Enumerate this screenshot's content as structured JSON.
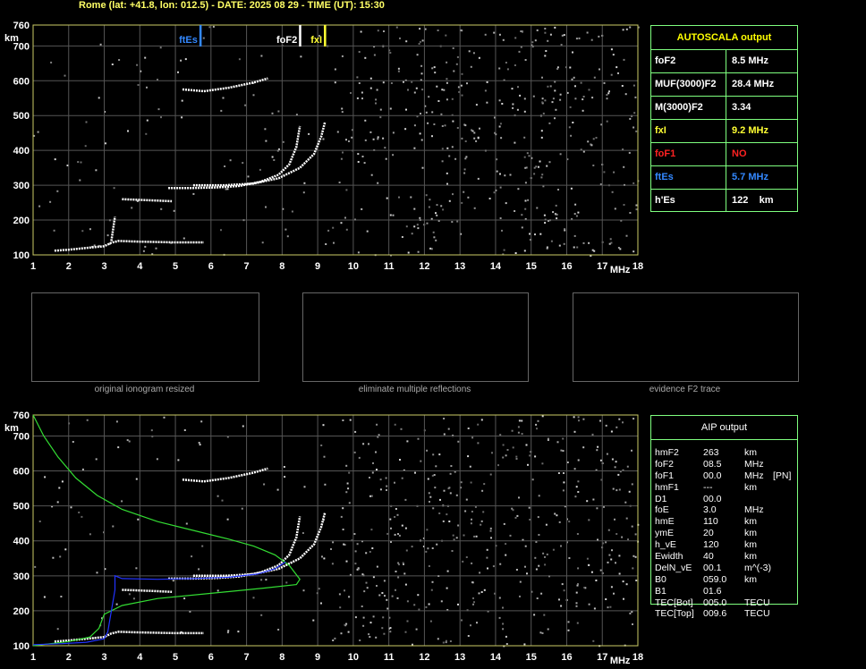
{
  "header": {
    "title": "Rome (lat: +41.8, lon: 012.5) - DATE: 2025 08 29 - TIME (UT): 15:30"
  },
  "axes": {
    "y_unit": "km",
    "x_unit": "MHz",
    "y_ticks": [
      "100",
      "200",
      "300",
      "400",
      "500",
      "600",
      "700",
      "760"
    ],
    "x_ticks": [
      "1",
      "2",
      "3",
      "4",
      "5",
      "6",
      "7",
      "8",
      "9",
      "10",
      "11",
      "12",
      "13",
      "14",
      "15",
      "16",
      "17",
      "18"
    ]
  },
  "markers": {
    "ftEs": "ftEs",
    "foF2": "foF2",
    "fxI": "fxI"
  },
  "autoscala": {
    "title": "AUTOSCALA output",
    "rows": [
      {
        "label": "foF2",
        "value": "8.5 MHz",
        "color": "#ffffff"
      },
      {
        "label": "MUF(3000)F2",
        "value": "28.4 MHz",
        "color": "#ffffff"
      },
      {
        "label": "M(3000)F2",
        "value": "3.34",
        "color": "#ffffff"
      },
      {
        "label": "fxI",
        "value": "9.2 MHz",
        "color": "#ffff33"
      },
      {
        "label": "foF1",
        "value": "NO",
        "color": "#ff2222"
      },
      {
        "label": "ftEs",
        "value": "5.7 MHz",
        "color": "#3388ff"
      },
      {
        "label": "h'Es",
        "value": "122    km",
        "color": "#ffffff"
      }
    ]
  },
  "thumbnails": {
    "captions": [
      "original ionogram resized",
      "eliminate multiple reflections",
      "evidence F2 trace"
    ]
  },
  "aip": {
    "title": "AIP output",
    "rows": [
      {
        "name": "hmF2",
        "value": "263",
        "unit": "km",
        "extra": ""
      },
      {
        "name": "foF2",
        "value": "08.5",
        "unit": "MHz",
        "extra": ""
      },
      {
        "name": "foF1",
        "value": "00.0",
        "unit": "MHz",
        "extra": "[PN]"
      },
      {
        "name": "hmF1",
        "value": "---",
        "unit": "km",
        "extra": ""
      },
      {
        "name": "D1",
        "value": "00.0",
        "unit": "",
        "extra": ""
      },
      {
        "name": "foE",
        "value": "3.0",
        "unit": "MHz",
        "extra": ""
      },
      {
        "name": "hmE",
        "value": "110",
        "unit": "km",
        "extra": ""
      },
      {
        "name": "ymE",
        "value": "20",
        "unit": "km",
        "extra": ""
      },
      {
        "name": "h_vE",
        "value": "120",
        "unit": "km",
        "extra": ""
      },
      {
        "name": "Ewidth",
        "value": "40",
        "unit": "km",
        "extra": ""
      },
      {
        "name": "DelN_vE",
        "value": "00.1",
        "unit": "m^(-3)",
        "extra": ""
      },
      {
        "name": "B0",
        "value": "059.0",
        "unit": "km",
        "extra": ""
      },
      {
        "name": "B1",
        "value": "01.6",
        "unit": "",
        "extra": ""
      },
      {
        "name": "TEC[Bot]",
        "value": "005.0",
        "unit": "TECU",
        "extra": ""
      },
      {
        "name": "TEC[Top]",
        "value": "009.6",
        "unit": "TECU",
        "extra": ""
      }
    ]
  },
  "chart_data": [
    {
      "type": "scatter",
      "title": "",
      "xlabel": "MHz",
      "ylabel": "km",
      "xlim": [
        1,
        18
      ],
      "ylim": [
        100,
        760
      ],
      "grid": true,
      "markers": [
        {
          "label": "ftEs",
          "x": 5.7,
          "color": "#3388ff"
        },
        {
          "label": "foF2",
          "x": 8.5,
          "color": "#ffffff"
        },
        {
          "label": "fxI",
          "x": 9.2,
          "color": "#ffff33"
        }
      ],
      "series": [
        {
          "color": "#ffffff",
          "points": [
            [
              1.6,
              112
            ],
            [
              2.0,
              115
            ],
            [
              2.5,
              120
            ],
            [
              3.0,
              125
            ],
            [
              3.2,
              135
            ],
            [
              3.4,
              140
            ],
            [
              4.0,
              138
            ],
            [
              5.0,
              136
            ],
            [
              5.8,
              136
            ]
          ]
        },
        {
          "color": "#ffffff",
          "points": [
            [
              3.2,
              140
            ],
            [
              3.25,
              175
            ],
            [
              3.3,
              210
            ]
          ]
        },
        {
          "color": "#ffffff",
          "points": [
            [
              4.8,
              292
            ],
            [
              5.5,
              292
            ],
            [
              6.2,
              294
            ],
            [
              6.8,
              298
            ],
            [
              7.4,
              310
            ],
            [
              7.9,
              330
            ],
            [
              8.2,
              360
            ],
            [
              8.4,
              410
            ],
            [
              8.5,
              470
            ]
          ]
        },
        {
          "color": "#ffffff",
          "points": [
            [
              5.5,
              300
            ],
            [
              6.4,
              300
            ],
            [
              7.2,
              305
            ],
            [
              7.9,
              320
            ],
            [
              8.5,
              350
            ],
            [
              8.9,
              390
            ],
            [
              9.1,
              440
            ],
            [
              9.2,
              480
            ]
          ]
        },
        {
          "color": "#ffffff",
          "points": [
            [
              3.5,
              260
            ],
            [
              4.0,
              258
            ],
            [
              4.5,
              256
            ],
            [
              4.9,
              254
            ]
          ]
        },
        {
          "color": "#ffffff",
          "points": [
            [
              5.2,
              575
            ],
            [
              5.8,
              570
            ],
            [
              6.5,
              580
            ],
            [
              7.2,
              595
            ],
            [
              7.6,
              607
            ]
          ]
        }
      ]
    },
    {
      "type": "line",
      "title": "",
      "xlabel": "MHz",
      "ylabel": "km",
      "xlim": [
        1,
        18
      ],
      "ylim": [
        100,
        760
      ],
      "grid": true,
      "series": [
        {
          "color": "#ffffff",
          "points": [
            [
              1.6,
              112
            ],
            [
              2.0,
              115
            ],
            [
              2.5,
              120
            ],
            [
              3.0,
              125
            ],
            [
              3.2,
              135
            ],
            [
              3.4,
              140
            ],
            [
              4.0,
              138
            ],
            [
              5.0,
              136
            ],
            [
              5.8,
              136
            ]
          ]
        },
        {
          "color": "#ffffff",
          "points": [
            [
              4.8,
              292
            ],
            [
              5.5,
              292
            ],
            [
              6.2,
              294
            ],
            [
              6.8,
              298
            ],
            [
              7.4,
              310
            ],
            [
              7.9,
              330
            ],
            [
              8.2,
              360
            ],
            [
              8.4,
              410
            ],
            [
              8.5,
              470
            ]
          ]
        },
        {
          "color": "#ffffff",
          "points": [
            [
              5.5,
              300
            ],
            [
              6.4,
              300
            ],
            [
              7.2,
              305
            ],
            [
              7.9,
              320
            ],
            [
              8.5,
              350
            ],
            [
              8.9,
              390
            ],
            [
              9.1,
              440
            ],
            [
              9.2,
              480
            ]
          ]
        },
        {
          "color": "#ffffff",
          "points": [
            [
              3.5,
              260
            ],
            [
              4.0,
              258
            ],
            [
              4.5,
              256
            ],
            [
              4.9,
              254
            ]
          ]
        },
        {
          "color": "#ffffff",
          "points": [
            [
              5.2,
              575
            ],
            [
              5.8,
              570
            ],
            [
              6.5,
              580
            ],
            [
              7.2,
              595
            ],
            [
              7.6,
              607
            ]
          ]
        },
        {
          "color": "#33dd33",
          "points": [
            [
              1.0,
              760
            ],
            [
              1.3,
              700
            ],
            [
              1.7,
              640
            ],
            [
              2.2,
              580
            ],
            [
              2.8,
              530
            ],
            [
              3.5,
              490
            ],
            [
              4.5,
              455
            ],
            [
              5.5,
              430
            ],
            [
              6.5,
              405
            ],
            [
              7.2,
              385
            ],
            [
              7.8,
              360
            ],
            [
              8.2,
              330
            ],
            [
              8.5,
              290
            ],
            [
              8.4,
              275
            ],
            [
              7.5,
              265
            ],
            [
              6.0,
              250
            ],
            [
              4.5,
              235
            ],
            [
              3.5,
              215
            ],
            [
              3.0,
              190
            ],
            [
              2.85,
              150
            ],
            [
              2.6,
              125
            ],
            [
              2.0,
              112
            ],
            [
              1.0,
              100
            ]
          ]
        },
        {
          "color": "#2233ff",
          "points": [
            [
              1.0,
              103
            ],
            [
              1.8,
              106
            ],
            [
              2.5,
              110
            ],
            [
              3.0,
              120
            ],
            [
              3.1,
              140
            ],
            [
              3.2,
              200
            ],
            [
              3.3,
              260
            ],
            [
              3.3,
              300
            ],
            [
              3.5,
              292
            ],
            [
              4.5,
              290
            ],
            [
              5.5,
              292
            ],
            [
              6.5,
              296
            ],
            [
              7.3,
              305
            ],
            [
              7.8,
              320
            ],
            [
              8.1,
              340
            ]
          ]
        }
      ]
    }
  ]
}
